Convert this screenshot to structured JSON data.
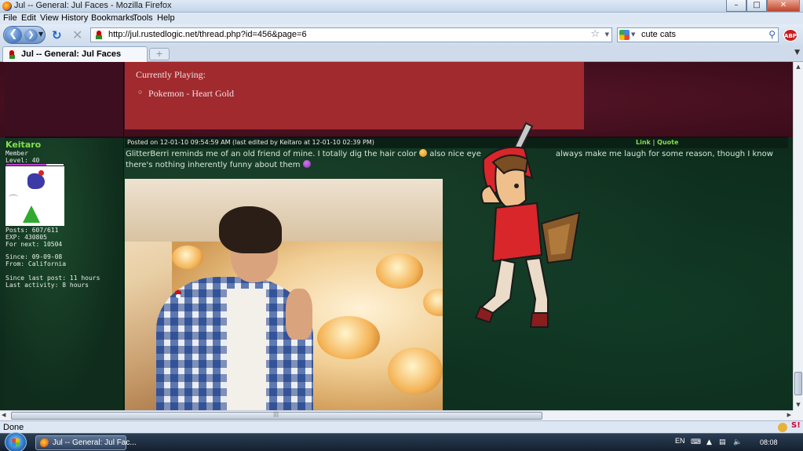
{
  "window": {
    "title": "Jul -- General: Jul Faces - Mozilla Firefox",
    "controls": {
      "minimize": "–",
      "maximize": "□",
      "close": "✕"
    }
  },
  "menu": [
    "File",
    "Edit",
    "View",
    "History",
    "Bookmarks",
    "Tools",
    "Help"
  ],
  "navigation": {
    "url": "http://jul.rustedlogic.net/thread.php?id=456&page=6",
    "search_query": "cute cats",
    "icons": [
      "back-icon",
      "forward-icon",
      "reload-icon",
      "stop-icon",
      "bookmark-star-icon",
      "search-icon",
      "adblock-icon"
    ]
  },
  "tabs": [
    {
      "label": "Jul -- General: Jul Faces",
      "active": true
    }
  ],
  "signature": {
    "heading": "Currently Playing:",
    "items": [
      "Pokemon - Heart Gold"
    ]
  },
  "user": {
    "name": "Keitaro",
    "rank": "Member",
    "level": "Level: 40",
    "level_progress": 0.7,
    "posts": "Posts: 607/611",
    "exp": "EXP: 430805",
    "for_next": "For next: 10504",
    "since": "Since: 09-09-08",
    "from": "From: California",
    "since_last_post": "Since last post: 11 hours",
    "last_activity": "Last activity: 8 hours"
  },
  "post": {
    "posted": "Posted on 12-01-10 09:54:59 AM (last edited by Keitaro at 12-01-10 02:39 PM)",
    "link_label": "Link",
    "separator": "|",
    "quote_label": "Quote",
    "text_part1": "GlitterBerri reminds me of an old friend of mine. I totally dig the hair color",
    "text_part2": "also nice eye",
    "text_part3": "always make me laugh for some reason, though I know there's nothing inherently funny about them"
  },
  "status": {
    "text": "Done"
  },
  "taskbar": {
    "task_label": "Jul -- General: Jul Fac...",
    "language": "EN",
    "clock": "08:08"
  },
  "colors": {
    "username": "#7fe24a",
    "signature_bg": "#a02a2e",
    "board_bg": "#0d2a1b"
  }
}
